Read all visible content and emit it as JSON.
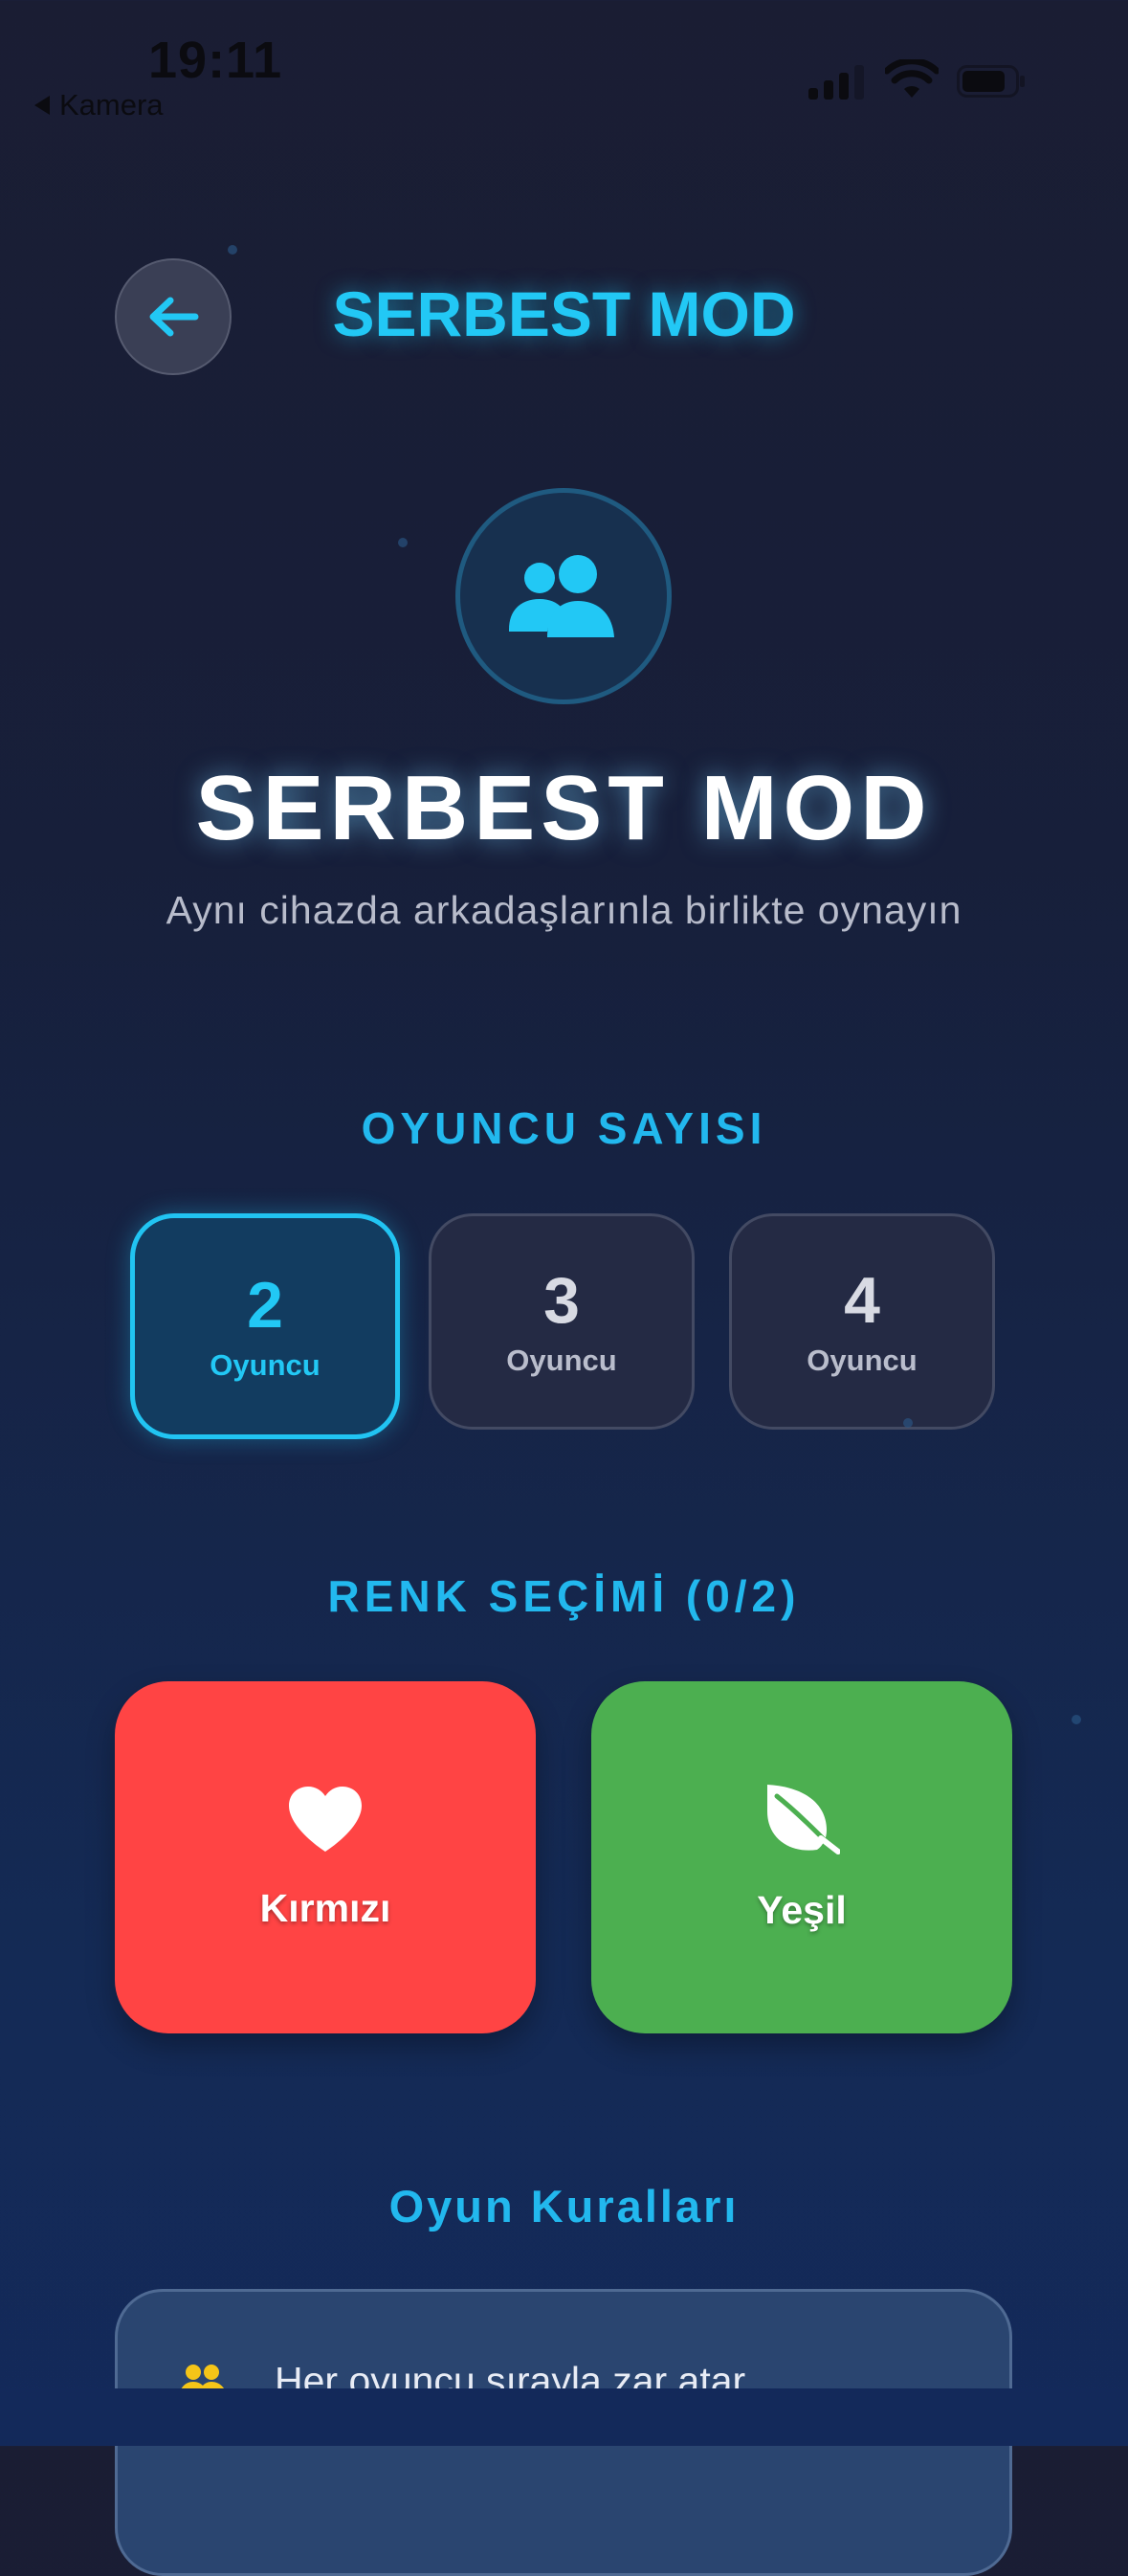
{
  "status_bar": {
    "time": "19:11",
    "back_app": "Kamera"
  },
  "header": {
    "title": "SERBEST MOD"
  },
  "hero": {
    "icon": "users-icon",
    "title": "SERBEST MOD",
    "subtitle": "Aynı cihazda arkadaşlarınla birlikte oynayın"
  },
  "player_count": {
    "heading": "OYUNCU SAYISI",
    "options": [
      {
        "number": "2",
        "label": "Oyuncu",
        "selected": true
      },
      {
        "number": "3",
        "label": "Oyuncu",
        "selected": false
      },
      {
        "number": "4",
        "label": "Oyuncu",
        "selected": false
      }
    ]
  },
  "color_selection": {
    "heading": "RENK SEÇİMİ (0/2)",
    "colors": [
      {
        "label": "Kırmızı",
        "icon": "heart-icon",
        "color": "#FF4444"
      },
      {
        "label": "Yeşil",
        "icon": "leaf-icon",
        "color": "#4CAF50"
      }
    ]
  },
  "rules": {
    "heading": "Oyun Kuralları",
    "items": [
      {
        "icon": "users-icon",
        "text": "Her oyuncu sırayla zar atar"
      }
    ]
  },
  "colors": {
    "accent": "#22C8F5",
    "background": "#1A1D33"
  }
}
